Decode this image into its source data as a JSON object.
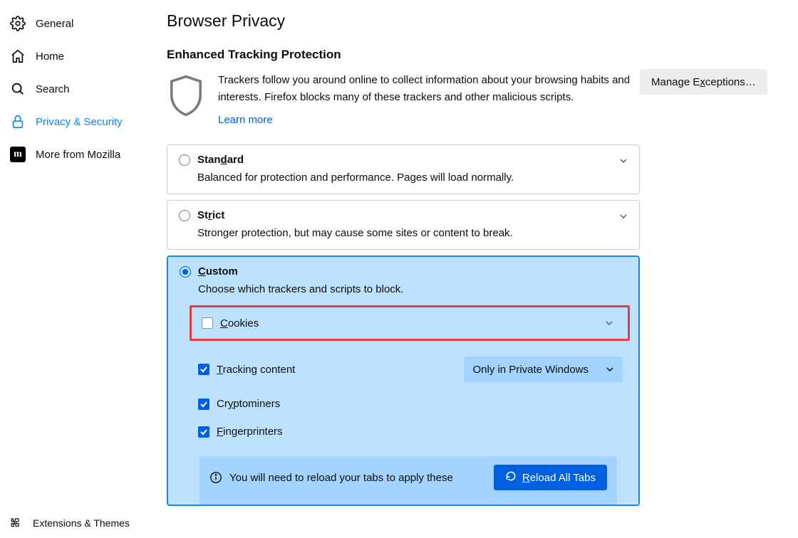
{
  "sidebar": {
    "items": [
      {
        "label": "General"
      },
      {
        "label": "Home"
      },
      {
        "label": "Search"
      },
      {
        "label": "Privacy & Security"
      },
      {
        "label": "More from Mozilla"
      }
    ],
    "bottom": {
      "label": "Extensions & Themes"
    }
  },
  "page": {
    "title": "Browser Privacy",
    "etp": {
      "heading": "Enhanced Tracking Protection",
      "desc": "Trackers follow you around online to collect information about your browsing habits and interests. Firefox blocks many of these trackers and other malicious scripts.",
      "learn_more": "Learn more",
      "manage_exceptions": "Manage Exceptions…"
    },
    "levels": {
      "standard": {
        "title_pre": "Stan",
        "title_u": "d",
        "title_post": "ard",
        "desc": "Balanced for protection and performance. Pages will load normally."
      },
      "strict": {
        "title_pre": "St",
        "title_u": "r",
        "title_post": "ict",
        "desc": "Stronger protection, but may cause some sites or content to break."
      },
      "custom": {
        "title_u": "C",
        "title_post": "ustom",
        "desc": "Choose which trackers and scripts to block."
      }
    },
    "custom": {
      "cookies_label_u": "C",
      "cookies_label_post": "ookies",
      "tracking_label_u": "T",
      "tracking_label_post": "racking content",
      "tracking_select": "Only in Private Windows",
      "crypto_label_pre": "Cr",
      "crypto_label_u": "y",
      "crypto_label_post": "ptominers",
      "finger_label_u": "F",
      "finger_label_post": "ingerprinters",
      "reload_info": "You will need to reload your tabs to apply these",
      "reload_btn_u": "R",
      "reload_btn_post": "eload All Tabs"
    }
  }
}
